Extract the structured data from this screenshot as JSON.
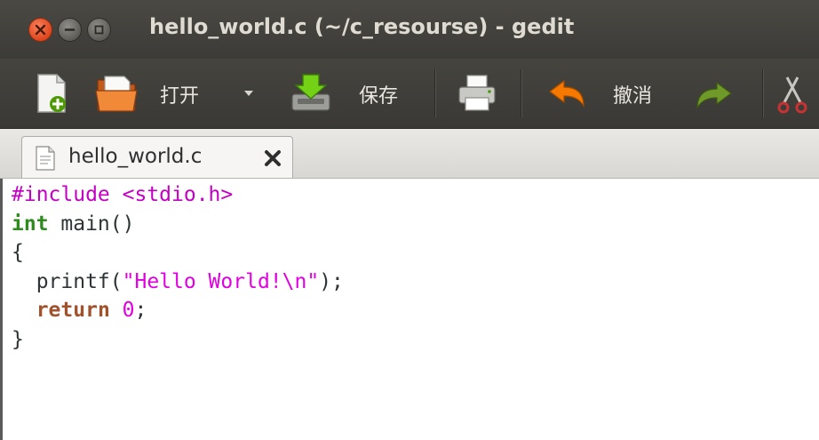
{
  "window": {
    "title": "hello_world.c (~/c_resourse) - gedit"
  },
  "toolbar": {
    "open_label": "打开",
    "save_label": "保存",
    "undo_label": "撤消",
    "icons": [
      "new-document-icon",
      "open-folder-icon",
      "dropdown-arrow-icon",
      "save-icon",
      "print-icon",
      "undo-icon",
      "redo-icon",
      "cut-icon"
    ]
  },
  "tabs": [
    {
      "label": "hello_world.c",
      "active": true
    }
  ],
  "editor": {
    "lines": [
      [
        {
          "t": "#include <stdio.h>",
          "c": "pp"
        }
      ],
      [
        {
          "t": "int",
          "c": "kw"
        },
        {
          "t": " main()",
          "c": ""
        }
      ],
      [
        {
          "t": "{",
          "c": ""
        }
      ],
      [
        {
          "t": "  printf(",
          "c": ""
        },
        {
          "t": "\"Hello World!\\n\"",
          "c": "str"
        },
        {
          "t": ");",
          "c": ""
        }
      ],
      [
        {
          "t": "  ",
          "c": ""
        },
        {
          "t": "return",
          "c": "rt"
        },
        {
          "t": " ",
          "c": ""
        },
        {
          "t": "0",
          "c": "num"
        },
        {
          "t": ";",
          "c": ""
        }
      ],
      [
        {
          "t": "}",
          "c": ""
        }
      ]
    ]
  },
  "colors": {
    "titlebar": "#3c3b37",
    "close_button": "#e0461c",
    "preprocessor": "#c400c4",
    "keyword": "#2e8b1e",
    "string": "#e000e0"
  }
}
